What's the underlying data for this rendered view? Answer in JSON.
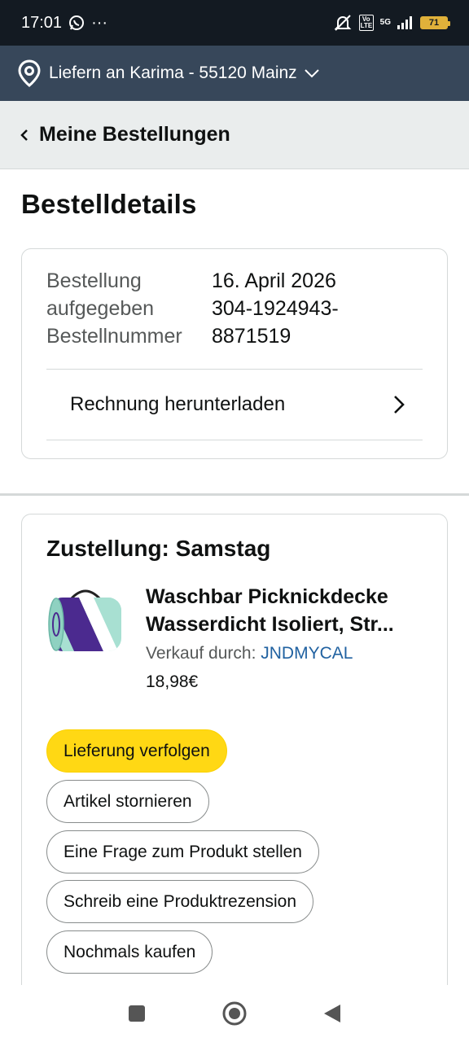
{
  "status_bar": {
    "time": "17:01",
    "more": "···",
    "network": "5G",
    "volte": "Vo LTE",
    "battery": "71"
  },
  "delivery_bar": {
    "text": "Liefern an Karima - 55120 Mainz"
  },
  "back_bar": {
    "label": "Meine Bestellungen"
  },
  "page": {
    "title": "Bestelldetails"
  },
  "order_info": {
    "placed_label": "Bestellung aufgegeben",
    "placed_label_line1": "Bestellung",
    "placed_label_line2": "aufgegeben",
    "placed_value": "16. April 2026",
    "number_label": "Bestellnummer",
    "number_value_line1": "304-1924943-",
    "number_value_line2": "8871519",
    "invoice_label": "Rechnung herunterladen"
  },
  "shipment": {
    "heading": "Zustellung: Samstag",
    "product_title_line1": "Waschbar Picknickdecke",
    "product_title_line2": "Wasserdicht Isoliert, Str...",
    "seller_prefix": "Verkauf durch: ",
    "seller_name": "JNDMYCAL",
    "price": "18,98€"
  },
  "actions": {
    "track": "Lieferung verfolgen",
    "cancel": "Artikel stornieren",
    "question": "Eine Frage zum Produkt stellen",
    "review": "Schreib eine Produktrezension",
    "buy_again": "Nochmals kaufen"
  },
  "colors": {
    "status_bar": "#131a22",
    "delivery_bar": "#37475a",
    "primary_button": "#ffd814",
    "link": "#2162a1"
  },
  "icons": [
    "whatsapp-icon",
    "silent-icon",
    "signal-icon",
    "battery-icon",
    "location-pin-icon",
    "chevron-down-icon",
    "chevron-left-icon",
    "chevron-right-icon",
    "nav-recents-icon",
    "nav-home-icon",
    "nav-back-icon"
  ]
}
